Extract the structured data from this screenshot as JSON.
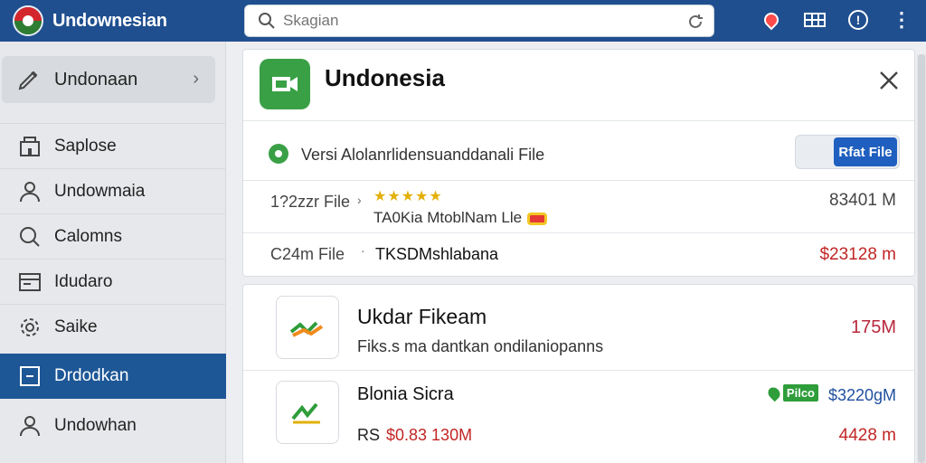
{
  "topbar": {
    "app_title": "Undownesian",
    "search_placeholder": "Skagian"
  },
  "sidebar": {
    "header": {
      "label": "Undonaan"
    },
    "items": [
      {
        "label": "Saplose",
        "icon": "building-icon"
      },
      {
        "label": "Undowmaia",
        "icon": "user-icon"
      },
      {
        "label": "Calomns",
        "icon": "search-icon"
      },
      {
        "label": "Idudaro",
        "icon": "window-icon"
      },
      {
        "label": "Saike",
        "icon": "settings-icon"
      },
      {
        "label": "Drdodkan",
        "icon": "square-icon",
        "active": true
      },
      {
        "label": "Undowhan",
        "icon": "user-outline-icon"
      }
    ]
  },
  "card": {
    "title": "Undonesia",
    "version_text": "Versi Alolanrlidensuanddanali File",
    "toggle_label": "Rfat File",
    "row1": {
      "label": "1?2zzr File",
      "sep": "›",
      "stars": "★★★★★",
      "sub": "TA0Kia MtoblNam Lle",
      "value": "83401 M"
    },
    "row2": {
      "label": "C24m File",
      "sep": "·",
      "text": "TKSDMshlabana",
      "value": "$23128 m"
    }
  },
  "files": [
    {
      "title": "Ukdar Fikeam",
      "desc": "Fiks.s ma dantkan ondilaniopanns",
      "size": "175M"
    },
    {
      "title": "Blonia Sicra",
      "rs": "RS",
      "price": "$0.83 130M",
      "tag": "Pilco",
      "tag_value": "$3220gM",
      "size": "4428 m"
    }
  ]
}
